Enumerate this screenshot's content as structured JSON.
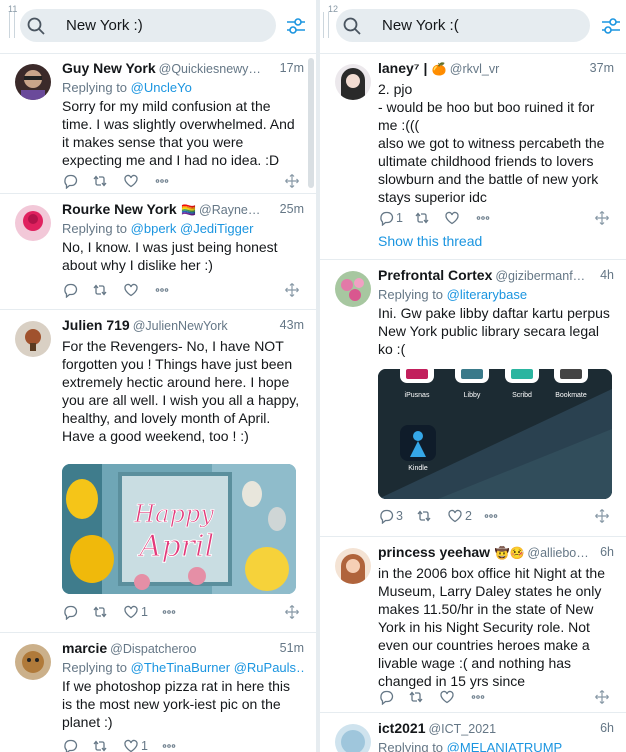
{
  "columns": [
    {
      "number": "11",
      "search_value": "New York :)",
      "tweets": [
        {
          "name": "Guy New York",
          "handle": "@Quickiesnewy…",
          "time": "17m",
          "replying_label": "Replying to",
          "replying_to": "@UncleYo",
          "text": "Sorry for my mild confusion at the time. I was slightly overwhelmed. And it makes sense that you were expecting me and I had no idea. :D",
          "like_count": "",
          "reply_count": "",
          "retweet_count": ""
        },
        {
          "name": "Rourke New York",
          "flag": "🏳️‍🌈",
          "handle": "@Rayne…",
          "time": "25m",
          "replying_label": "Replying to",
          "replying_to": "@bperk @JediTigger",
          "text": "No, I know. I was just being honest about why I dislike her :)",
          "like_count": ""
        },
        {
          "name": "Julien 719",
          "handle": "@JulienNewYork",
          "time": "43m",
          "text": "For the Revengers- No, I have NOT forgotten you ! Things have just been extremely hectic around here. I hope you are all well. I wish you all a happy, healthy, and lovely month of April. Have a good weekend, too ! :)",
          "media_text_top": "Happy",
          "media_text_bottom": "April",
          "like_count": "1"
        },
        {
          "name": "marcie",
          "handle": "@Dispatcheroo",
          "time": "51m",
          "replying_label": "Replying to",
          "replying_to": "@TheTinaBurner @RuPauls…",
          "text": "If we photoshop pizza rat in here this is the most new york-iest pic on the planet :)",
          "like_count": "1"
        }
      ]
    },
    {
      "number": "12",
      "search_value": "New York :(",
      "tweets": [
        {
          "name": "laney⁷ |",
          "badge": "🍊",
          "handle": "@rkvl_vr",
          "time": "37m",
          "text": "2. pjo\n- would be hoo but boo ruined it for me :(((\nalso we got to witness percabeth the ultimate childhood friends to lovers slowburn and the battle of new york stays superior idc",
          "reply_count": "1",
          "show_thread": "Show this thread"
        },
        {
          "name": "Prefrontal Cortex",
          "handle": "@gizibermanf…",
          "time": "4h",
          "replying_label": "Replying to",
          "replying_to": "@literarybase",
          "text": "Ini. Gw pake libby daftar kartu perpus New York public library secara legal ko :(",
          "apps": [
            "iPusnas",
            "Libby",
            "Scribd",
            "Bookmate",
            "Kindle"
          ],
          "reply_count": "3",
          "like_count": "2"
        },
        {
          "name": "princess yeehaw",
          "badge": "🤠🤒",
          "handle": "@alliebo…",
          "time": "6h",
          "text": "in the 2006 box office hit Night at the Museum, Larry Daley states he only makes 11.50/hr in the state of New York in his Night Security role. Not even our countries heroes make a livable wage :( and nothing has changed in 15 yrs since"
        },
        {
          "name": "ict2021",
          "handle": "@ICT_2021",
          "time": "6h",
          "replying_label": "Replying to",
          "replying_to": "@MELANIATRUMP"
        }
      ]
    }
  ],
  "colors": {
    "accent": "#1b95e0",
    "muted": "#657786",
    "border": "#e6ecf0"
  },
  "icons": [
    "search-icon",
    "filter-icon",
    "reply-icon",
    "retweet-icon",
    "like-icon",
    "more-icon",
    "move-icon"
  ]
}
